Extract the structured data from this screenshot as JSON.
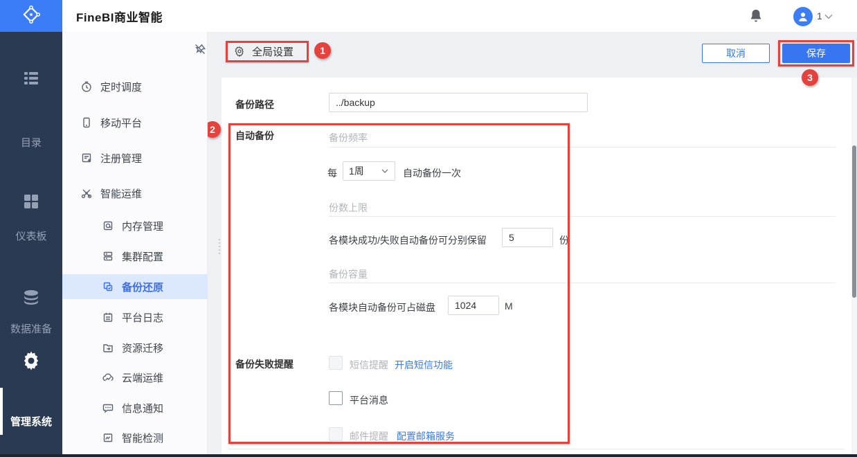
{
  "topbar": {
    "title": "FineBI商业智能",
    "user_count": "1"
  },
  "sidebar": {
    "items": [
      {
        "label": "目录"
      },
      {
        "label": "仪表板"
      },
      {
        "label": "数据准备"
      },
      {
        "label": "管理系统",
        "active": true
      }
    ]
  },
  "menu": {
    "items": [
      {
        "label": "定时调度"
      },
      {
        "label": "移动平台"
      },
      {
        "label": "注册管理"
      },
      {
        "label": "智能运维"
      },
      {
        "label": "内存管理"
      },
      {
        "label": "集群配置"
      },
      {
        "label": "备份还原",
        "selected": true
      },
      {
        "label": "平台日志"
      },
      {
        "label": "资源迁移"
      },
      {
        "label": "云端运维"
      },
      {
        "label": "信息通知"
      },
      {
        "label": "智能检测"
      }
    ]
  },
  "toolbar": {
    "global_settings_label": "全局设置",
    "cancel_label": "取消",
    "save_label": "保存"
  },
  "annotations": {
    "badge1": "1",
    "badge2": "2",
    "badge3": "3",
    "color": "#e5413d"
  },
  "form": {
    "backup_path_label": "备份路径",
    "backup_path_value": "../backup",
    "auto_backup_label": "自动备份",
    "frequency_label": "备份频率",
    "every_prefix": "每",
    "frequency_value": "1周",
    "every_suffix": "自动备份一次",
    "count_limit_label": "份数上限",
    "count_limit_text": "各模块成功/失败自动备份可分别保留",
    "count_limit_value": "5",
    "count_limit_unit": "份",
    "capacity_label": "备份容量",
    "capacity_text": "各模块自动备份可占磁盘",
    "capacity_value": "1024",
    "capacity_unit": "M",
    "fail_alert_label": "备份失败提醒",
    "sms_label": "短信提醒",
    "sms_link": "开启短信功能",
    "platform_msg_label": "平台消息",
    "email_label": "邮件提醒",
    "email_link": "配置邮箱服务"
  },
  "colors": {
    "brand_blue": "#3b7cf7",
    "primary_button": "#3875f1",
    "selected_menu": "#3a6ef5",
    "annotation_red": "#e5413d",
    "dark_sidebar": "#2b3a53"
  }
}
